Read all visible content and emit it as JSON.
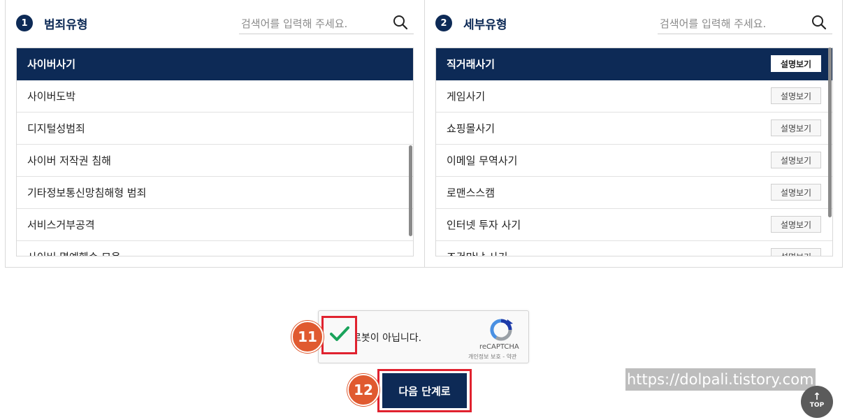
{
  "crime_type": {
    "number": "1",
    "title": "범죄유형",
    "search_placeholder": "검색어를 입력해 주세요.",
    "items": [
      {
        "label": "사이버사기",
        "selected": true
      },
      {
        "label": "사이버도박"
      },
      {
        "label": "디지털성범죄"
      },
      {
        "label": "사이버 저작권 침해"
      },
      {
        "label": "기타정보통신망침해형 범죄"
      },
      {
        "label": "서비스거부공격"
      },
      {
        "label": "사이버 명예훼손 모욕"
      }
    ]
  },
  "detail_type": {
    "number": "2",
    "title": "세부유형",
    "search_placeholder": "검색어를 입력해 주세요.",
    "detail_button": "설명보기",
    "items": [
      {
        "label": "직거래사기",
        "selected": true
      },
      {
        "label": "게임사기"
      },
      {
        "label": "쇼핑몰사기"
      },
      {
        "label": "이메일 무역사기"
      },
      {
        "label": "로맨스스캠"
      },
      {
        "label": "인터넷 투자 사기"
      },
      {
        "label": "조건만남 사기"
      }
    ]
  },
  "recaptcha": {
    "label": "로봇이 아닙니다.",
    "checked": true,
    "brand": "reCAPTCHA",
    "privacy": "개인정보 보호",
    "separator": " - ",
    "terms": "약관"
  },
  "annotations": {
    "step11": "11",
    "step12": "12"
  },
  "next_button": "다음 단계로",
  "watermark": "https://dolpali.tistory.com",
  "top_button": "TOP",
  "colors": {
    "navy": "#0d2a56",
    "highlight": "#e0222f",
    "badge": "#e05a30",
    "check": "#1aa35b"
  }
}
